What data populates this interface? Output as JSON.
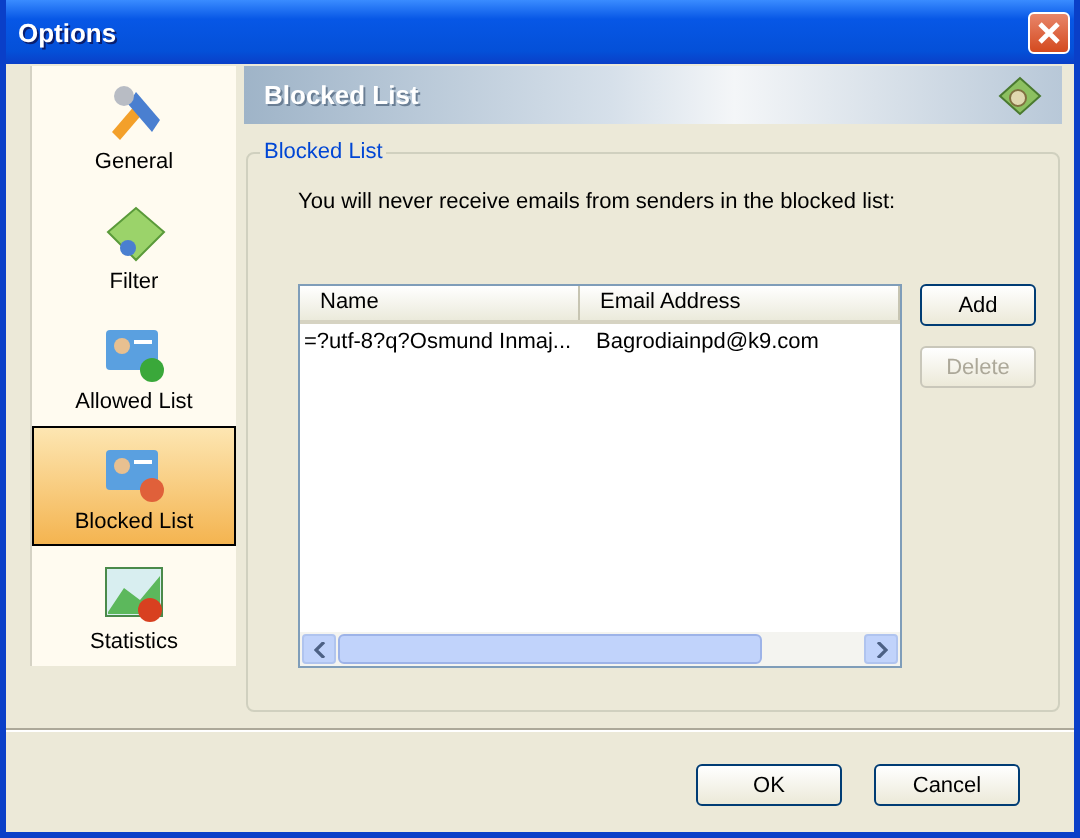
{
  "window": {
    "title": "Options"
  },
  "sidebar": {
    "items": [
      {
        "label": "General",
        "kind": "general",
        "selected": false
      },
      {
        "label": "Filter",
        "kind": "filter",
        "selected": false
      },
      {
        "label": "Allowed List",
        "kind": "allowed",
        "selected": false
      },
      {
        "label": "Blocked List",
        "kind": "blocked",
        "selected": true
      },
      {
        "label": "Statistics",
        "kind": "statistics",
        "selected": false
      }
    ]
  },
  "header": {
    "title": "Blocked List"
  },
  "group": {
    "title": "Blocked List",
    "description": "You will never receive emails from senders in the blocked list:"
  },
  "table": {
    "columns": [
      "Name",
      "Email Address"
    ],
    "rows": [
      [
        "=?utf-8?q?Osmund Inmaj...",
        "Bagrodiainpd@k9.com"
      ]
    ]
  },
  "side_buttons": [
    {
      "label": "Add",
      "disabled": false
    },
    {
      "label": "Delete",
      "disabled": true
    }
  ],
  "buttons": [
    "OK",
    "Cancel"
  ]
}
